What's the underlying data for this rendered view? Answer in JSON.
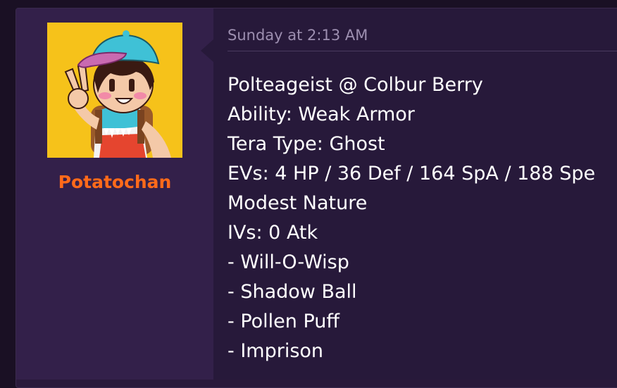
{
  "post": {
    "username": "Potatochan",
    "timestamp": "Sunday at 2:13 AM",
    "lines": [
      "Polteageist @ Colbur Berry",
      "Ability: Weak Armor",
      "Tera Type: Ghost",
      "EVs: 4 HP / 36 Def / 164 SpA / 188 Spe",
      "Modest Nature",
      "IVs: 0 Atk",
      "- Will-O-Wisp",
      "- Shadow Ball",
      "- Pollen Puff",
      "- Imprison"
    ]
  },
  "colors": {
    "background": "#1a1024",
    "user_column": "#33204a",
    "content": "#27193a",
    "username": "#ff6a1a",
    "timestamp": "#9d8fb0",
    "text": "#ffffff",
    "avatar_bg": "#f6c21a"
  }
}
